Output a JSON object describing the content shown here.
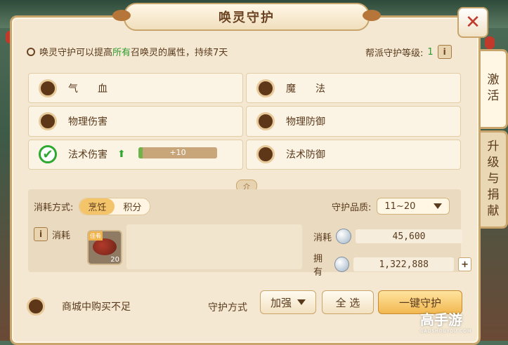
{
  "window": {
    "title": "唤灵守护"
  },
  "info": {
    "desc_before": "唤灵守护可以提高",
    "desc_highlight": "所有",
    "desc_after": "召唤灵的属性，持续7天",
    "guild_level_label": "帮派守护等级:",
    "guild_level_value": "1"
  },
  "attributes": [
    {
      "label": "气　　血",
      "checked": false
    },
    {
      "label": "魔　　法",
      "checked": false
    },
    {
      "label": "物理伤害",
      "checked": false
    },
    {
      "label": "物理防御",
      "checked": false
    },
    {
      "label": "法术伤害",
      "checked": true,
      "progress_text": "+10",
      "progress": 0.05
    },
    {
      "label": "法术防御",
      "checked": false
    }
  ],
  "divider_glyph": "介",
  "consume": {
    "method_label": "消耗方式:",
    "options": [
      "烹饪",
      "积分"
    ],
    "selected": "烹饪",
    "quality_label": "守护品质:",
    "quality_value": "11~20",
    "consume_label": "消耗",
    "item_tag": "佳肴",
    "item_count": "20",
    "cost_label": "消耗",
    "cost_value": "45,600",
    "own_label": "拥有",
    "own_value": "1,322,888"
  },
  "bottom": {
    "insufficient_label": "商城中购买不足",
    "guard_mode_label": "守护方式",
    "mode_value": "加强",
    "select_all": "全 选",
    "one_key": "一键守护"
  },
  "tabs": [
    "激活",
    "升级与捐献"
  ],
  "watermark": {
    "main": "高手游",
    "sub": "GAOSHOUYOU.COM"
  },
  "colors": {
    "accent": "#2e9a2e",
    "panel": "#f4e8d2",
    "border": "#c9a46b",
    "close": "#c0392b"
  }
}
